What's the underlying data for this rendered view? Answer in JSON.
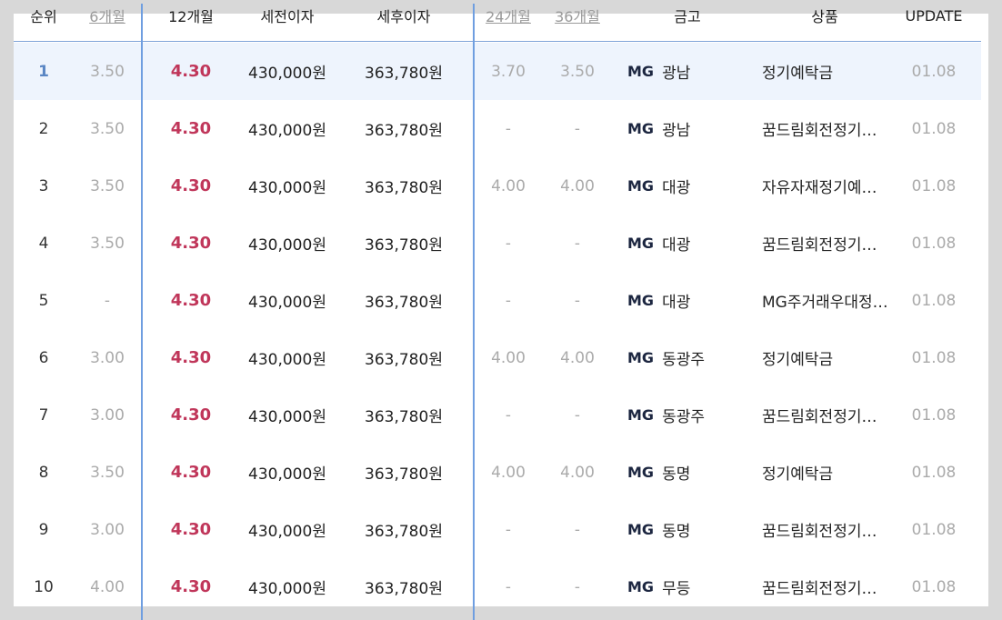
{
  "headers": {
    "rank": "순위",
    "m6": "6개월",
    "m12": "12개월",
    "pretax": "세전이자",
    "aftertax": "세후이자",
    "m24": "24개월",
    "m36": "36개월",
    "bank": "금고",
    "product": "상품",
    "update": "UPDATE"
  },
  "rows": [
    {
      "rank": "1",
      "m6": "3.50",
      "m12": "4.30",
      "pretax": "430,000원",
      "aftertax": "363,780원",
      "m24": "3.70",
      "m36": "3.50",
      "brand": "MG",
      "bank": "광남",
      "product": "정기예탁금",
      "update": "01.08"
    },
    {
      "rank": "2",
      "m6": "3.50",
      "m12": "4.30",
      "pretax": "430,000원",
      "aftertax": "363,780원",
      "m24": "-",
      "m36": "-",
      "brand": "MG",
      "bank": "광남",
      "product": "꿈드림회전정기…",
      "update": "01.08"
    },
    {
      "rank": "3",
      "m6": "3.50",
      "m12": "4.30",
      "pretax": "430,000원",
      "aftertax": "363,780원",
      "m24": "4.00",
      "m36": "4.00",
      "brand": "MG",
      "bank": "대광",
      "product": "자유자재정기예…",
      "update": "01.08"
    },
    {
      "rank": "4",
      "m6": "3.50",
      "m12": "4.30",
      "pretax": "430,000원",
      "aftertax": "363,780원",
      "m24": "-",
      "m36": "-",
      "brand": "MG",
      "bank": "대광",
      "product": "꿈드림회전정기…",
      "update": "01.08"
    },
    {
      "rank": "5",
      "m6": "-",
      "m12": "4.30",
      "pretax": "430,000원",
      "aftertax": "363,780원",
      "m24": "-",
      "m36": "-",
      "brand": "MG",
      "bank": "대광",
      "product": "MG주거래우대정…",
      "update": "01.08"
    },
    {
      "rank": "6",
      "m6": "3.00",
      "m12": "4.30",
      "pretax": "430,000원",
      "aftertax": "363,780원",
      "m24": "4.00",
      "m36": "4.00",
      "brand": "MG",
      "bank": "동광주",
      "product": "정기예탁금",
      "update": "01.08"
    },
    {
      "rank": "7",
      "m6": "3.00",
      "m12": "4.30",
      "pretax": "430,000원",
      "aftertax": "363,780원",
      "m24": "-",
      "m36": "-",
      "brand": "MG",
      "bank": "동광주",
      "product": "꿈드림회전정기…",
      "update": "01.08"
    },
    {
      "rank": "8",
      "m6": "3.50",
      "m12": "4.30",
      "pretax": "430,000원",
      "aftertax": "363,780원",
      "m24": "4.00",
      "m36": "4.00",
      "brand": "MG",
      "bank": "동명",
      "product": "정기예탁금",
      "update": "01.08"
    },
    {
      "rank": "9",
      "m6": "3.00",
      "m12": "4.30",
      "pretax": "430,000원",
      "aftertax": "363,780원",
      "m24": "-",
      "m36": "-",
      "brand": "MG",
      "bank": "동명",
      "product": "꿈드림회전정기…",
      "update": "01.08"
    },
    {
      "rank": "10",
      "m6": "4.00",
      "m12": "4.30",
      "pretax": "430,000원",
      "aftertax": "363,780원",
      "m24": "-",
      "m36": "-",
      "brand": "MG",
      "bank": "무등",
      "product": "꿈드림회전정기…",
      "update": "01.08"
    }
  ]
}
